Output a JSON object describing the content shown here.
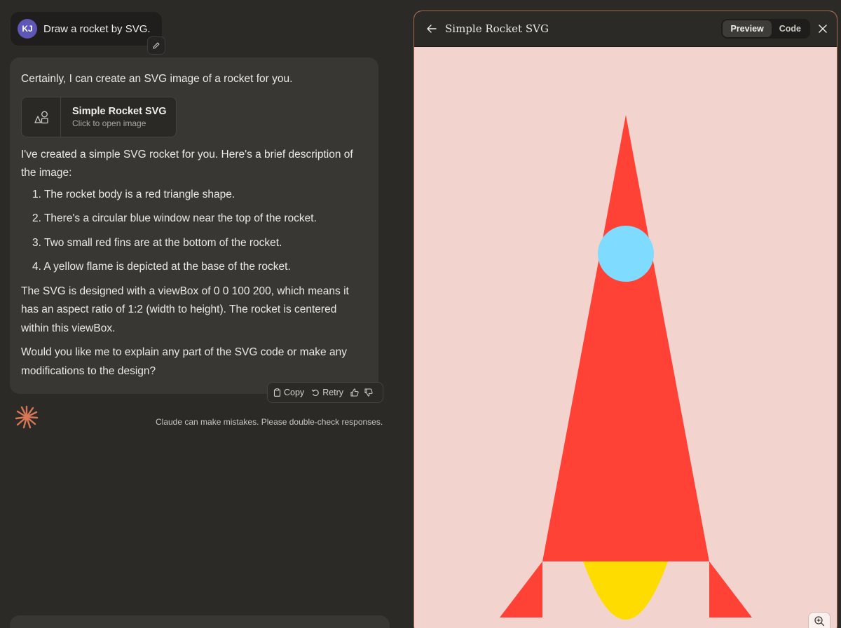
{
  "user_message": {
    "initials": "KJ",
    "text": "Draw a rocket by SVG."
  },
  "assistant": {
    "intro": "Certainly, I can create an SVG image of a rocket for you.",
    "artifact": {
      "title": "Simple Rocket SVG",
      "subtitle": "Click to open image"
    },
    "description_lead": "I've created a simple SVG rocket for you. Here's a brief description of the image:",
    "list_items": [
      "1. The rocket body is a red triangle shape.",
      "2. There's a circular blue window near the top of the rocket.",
      "3. Two small red fins are at the bottom of the rocket.",
      "4. A yellow flame is depicted at the base of the rocket."
    ],
    "viewbox_paragraph": "The SVG is designed with a viewBox of 0 0 100 200, which means it has an aspect ratio of 1:2 (width to height). The rocket is centered within this viewBox.",
    "closing_question": "Would you like me to explain any part of the SVG code or make any modifications to the design?",
    "actions": {
      "copy": "Copy",
      "retry": "Retry"
    }
  },
  "disclaimer": "Claude can make mistakes. Please double-check responses.",
  "panel": {
    "title": "Simple Rocket SVG",
    "tabs": {
      "preview": "Preview",
      "code": "Code"
    },
    "active_tab": "preview"
  },
  "icons": {
    "edit": "pencil-icon",
    "artifact": "shapes-icon",
    "copy": "clipboard-icon",
    "retry": "retry-icon",
    "thumbs_up": "thumbs-up-icon",
    "thumbs_down": "thumbs-down-icon",
    "logo": "claude-logo",
    "back": "arrow-left-icon",
    "close": "close-icon",
    "zoom_in": "zoom-in-icon",
    "zoom_out": "zoom-out-icon"
  },
  "colors": {
    "accent": "#d97757",
    "avatar": "#5f57b8",
    "rocket_body": "#ff4136",
    "rocket_window": "#7fdbff",
    "rocket_flame": "#ffdc00",
    "preview_background": "#f3d3ce",
    "panel_border": "#a36a4c"
  }
}
